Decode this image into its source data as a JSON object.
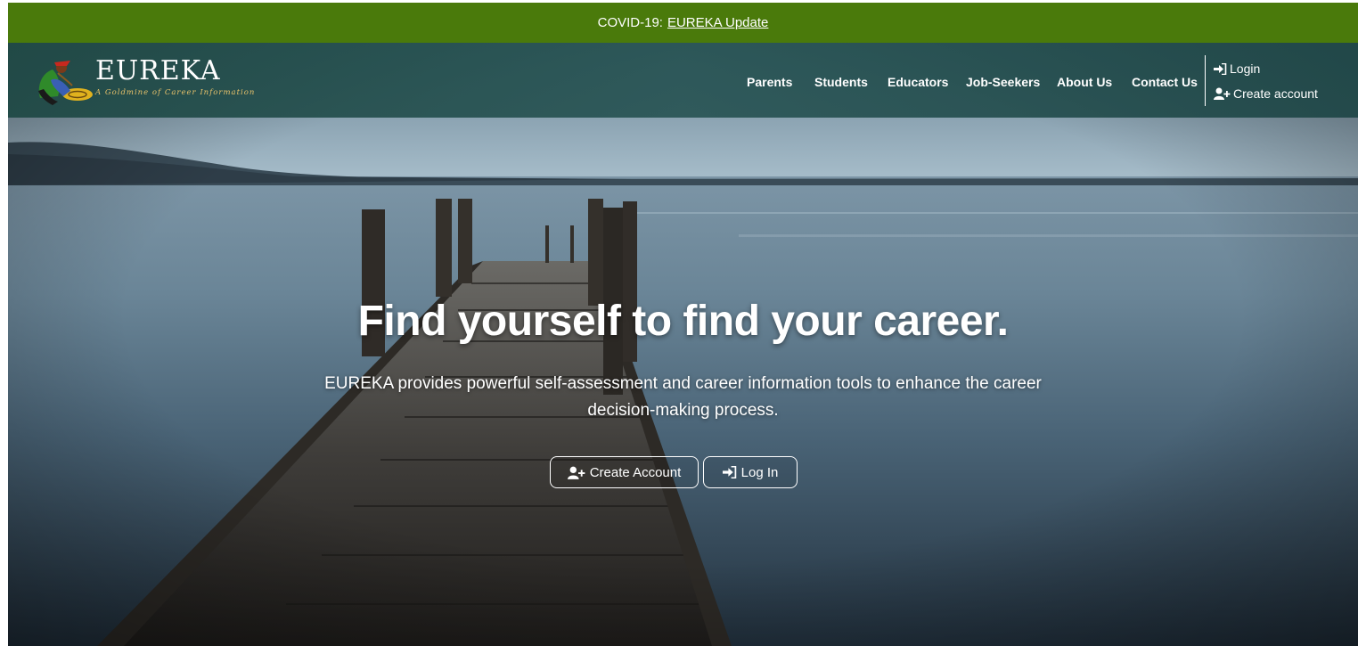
{
  "banner": {
    "prefix": "COVID-19:",
    "link": "EUREKA Update"
  },
  "brand": {
    "name": "EUREKA",
    "tagline": "A Goldmine of Career Information"
  },
  "nav": {
    "items": [
      "Parents",
      "Students",
      "Educators",
      "Job-Seekers",
      "About Us",
      "Contact Us"
    ],
    "login": "Login",
    "create_account": "Create account"
  },
  "hero": {
    "headline": "Find yourself to find your career.",
    "subtitle": "EUREKA provides powerful self-assessment and career information tools to enhance the career decision-making process.",
    "create_button": "Create Account",
    "login_button": "Log In"
  },
  "colors": {
    "banner": "#4a7a0b",
    "navbar": "#1f4a46",
    "text": "#ffffff",
    "tagline": "#e8c26a"
  }
}
